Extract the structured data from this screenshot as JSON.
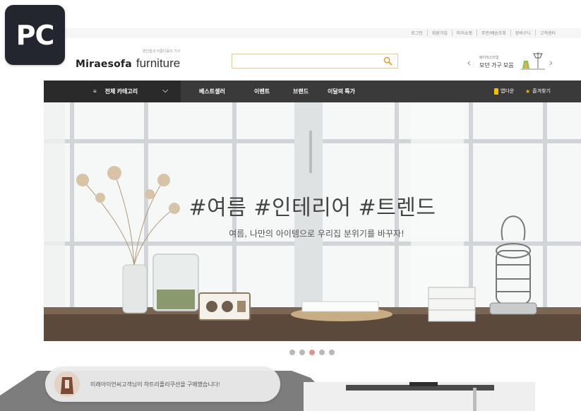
{
  "badge": {
    "label": "PC"
  },
  "utility_links": [
    "로그인",
    "회원가입",
    "마이쇼핑",
    "주문/배송조회",
    "장바구니",
    "고객센터"
  ],
  "header": {
    "logo_main": "Miraesofa",
    "logo_sub": "furniture",
    "logo_tagline": "편안함과 아름다움의 가구",
    "search_placeholder": "",
    "promo_small": "베이직스타일",
    "promo_text": "모던 가구 모음"
  },
  "nav": {
    "all_categories": "전체 카테고리",
    "items": [
      "베스트셀러",
      "이벤트",
      "브랜드",
      "이달의 특가"
    ],
    "app_label": "앱다운",
    "bookmark_label": "즐겨찾기"
  },
  "hero": {
    "title": "#여름 #인테리어 #트렌드",
    "subtitle": "여름, 나만의 아이템으로 우리집 분위기를 바꾸자!"
  },
  "carousel": {
    "total": 5,
    "active_index": 2
  },
  "toast": {
    "text": "미래아이언씨고객님이 하트리플리쿠션을 구매했습니다!"
  },
  "colors": {
    "nav_bg": "#3a3a3a",
    "nav_all_bg": "#2a2a2a",
    "accent_yellow": "#f2c200",
    "dot_active": "#e89090",
    "badge_bg": "#23262f"
  }
}
